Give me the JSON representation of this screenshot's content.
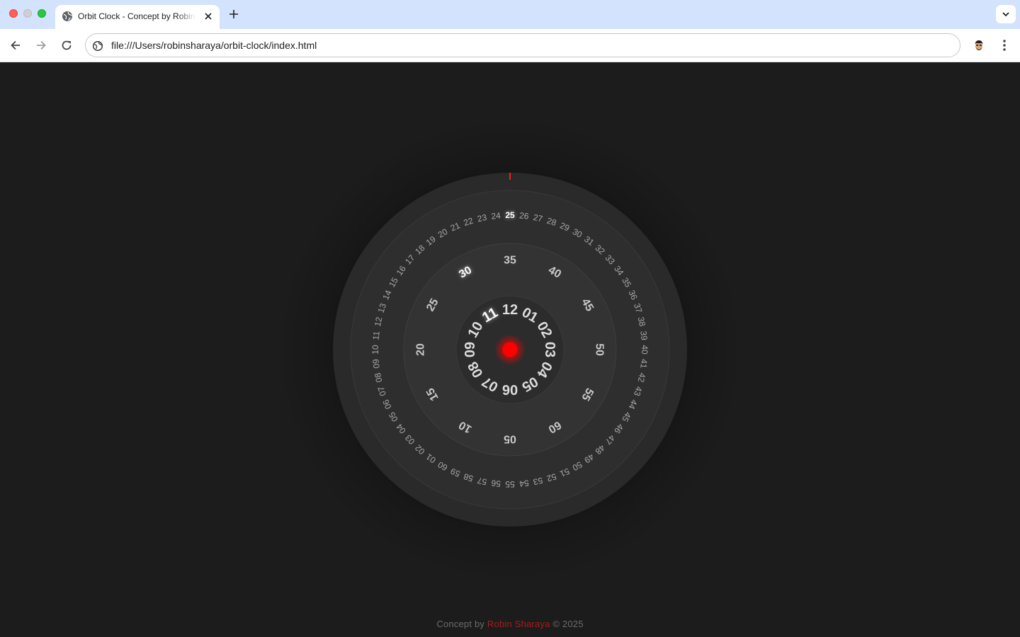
{
  "browser": {
    "tab_title": "Orbit Clock - Concept by Robin Sharaya",
    "url": "file:///Users/robinsharaya/orbit-clock/index.html",
    "icons": {
      "close": "close-icon",
      "minimize": "minimize-icon",
      "maximize": "maximize-icon",
      "favicon": "globe-icon",
      "tab_close": "x-icon",
      "new_tab": "plus-icon",
      "tab_search": "chevron-down-icon",
      "back": "arrow-left-icon",
      "forward": "arrow-right-icon",
      "reload": "reload-icon",
      "site_info": "globe-icon",
      "profile": "avatar-icon",
      "menu": "kebab-menu-icon"
    }
  },
  "clock": {
    "accent_color": "#ff0000",
    "hour_ring": {
      "labels": [
        "12",
        "01",
        "02",
        "03",
        "04",
        "05",
        "06",
        "07",
        "08",
        "09",
        "10",
        "11"
      ],
      "current": "11"
    },
    "minute_ring": {
      "labels": [
        "35",
        "40",
        "45",
        "50",
        "55",
        "60",
        "05",
        "10",
        "15",
        "20",
        "25",
        "30"
      ],
      "current": "30"
    },
    "second_ring": {
      "labels": [
        "25",
        "26",
        "27",
        "28",
        "29",
        "30",
        "31",
        "32",
        "33",
        "34",
        "35",
        "36",
        "37",
        "38",
        "39",
        "40",
        "41",
        "42",
        "43",
        "44",
        "45",
        "46",
        "47",
        "48",
        "49",
        "50",
        "51",
        "52",
        "53",
        "54",
        "55",
        "56",
        "57",
        "58",
        "59",
        "60",
        "01",
        "02",
        "03",
        "04",
        "05",
        "06",
        "07",
        "08",
        "09",
        "10",
        "11",
        "12",
        "13",
        "14",
        "15",
        "16",
        "17",
        "18",
        "19",
        "20",
        "21",
        "22",
        "23",
        "24"
      ],
      "current": "25"
    }
  },
  "footer": {
    "prefix": "Concept by ",
    "author": "Robin Sharaya",
    "suffix": " © 2025"
  }
}
